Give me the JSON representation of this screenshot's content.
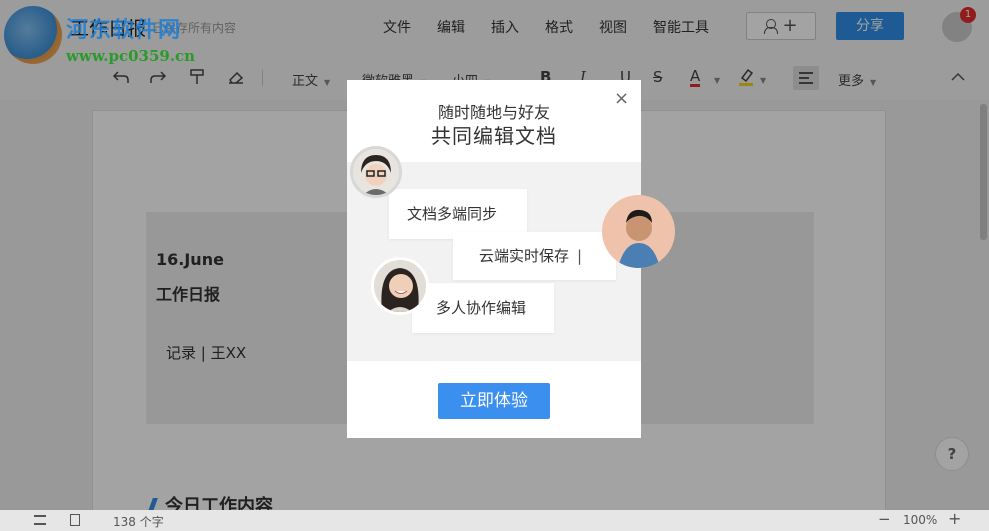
{
  "watermark": {
    "site": "河东软件网",
    "url": "www.pc0359.cn"
  },
  "header": {
    "doc_title": "工作日报",
    "save_status": "已保存所有内容",
    "menu": [
      "文件",
      "编辑",
      "插入",
      "格式",
      "视图",
      "智能工具"
    ],
    "share_label": "分享",
    "notification_count": "1"
  },
  "toolbar": {
    "style": "正文",
    "font": "微软雅黑",
    "size": "小四",
    "bold": "B",
    "italic": "I",
    "strike": "S",
    "font_color": "A",
    "more": "更多"
  },
  "document": {
    "date": "16.June",
    "title": "工作日报",
    "recorder": "记录 | 王XX",
    "section": "今日工作内容"
  },
  "help": "?",
  "status": {
    "word_count": "138 个字",
    "zoom": "100%",
    "zoom_out": "−",
    "zoom_in": "+"
  },
  "modal": {
    "line1": "随时随地与好友",
    "line2": "共同编辑文档",
    "bubbles": [
      "文档多端同步",
      "云端实时保存",
      "多人协作编辑"
    ],
    "cta": "立即体验",
    "close": "×"
  },
  "colors": {
    "accent": "#2f8fe8",
    "cta": "#3b8fef",
    "badge": "#e52b2b"
  }
}
